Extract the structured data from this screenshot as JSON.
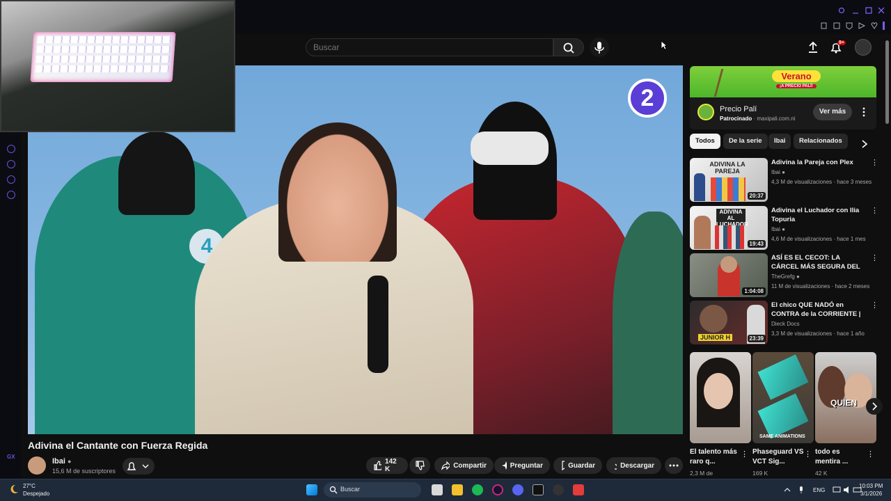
{
  "browser": {
    "accent": "#6b4fd8"
  },
  "header": {
    "search_placeholder": "Buscar",
    "notification_count": "9+"
  },
  "video": {
    "title": "Adivina el Cantante con Fuerza Regida",
    "badge_number": "2",
    "channel": "Ibai",
    "subscribers": "15,6 M de suscriptores",
    "likes": "142 K",
    "share_label": "Compartir",
    "ask_label": "Preguntar",
    "save_label": "Guardar",
    "download_label": "Descargar"
  },
  "ad": {
    "banner_text": "Verano",
    "banner_sub": "¡A PRECIO PALÍ!",
    "name": "Precio Palí",
    "sponsored": "Patrocinado",
    "domain": "maxipali.com.ni",
    "button": "Ver más"
  },
  "chips": [
    "Todos",
    "De la serie",
    "Ibai",
    "Relacionados"
  ],
  "recommendations": [
    {
      "title": "Adivina la Pareja con Plex",
      "channel": "Ibai",
      "meta": "4,3 M de visualizaciones · hace 3 meses",
      "duration": "20:37",
      "thumb_text": "ADIVINA LA PAREJA"
    },
    {
      "title": "Adivina el Luchador con Ilia Topuria",
      "channel": "Ibai",
      "meta": "4,6 M de visualizaciones · hace 1 mes",
      "duration": "19:43",
      "thumb_text": "ADIVINA AL LUCHADOR"
    },
    {
      "title": "ASÍ ES EL CECOT: LA CÁRCEL MÁS SEGURA DEL MUNDO",
      "channel": "TheGrefg",
      "meta": "11 M de visualizaciones · hace 2 meses",
      "duration": "1:04:08",
      "thumb_text": ""
    },
    {
      "title": "El chico QUE NADÓ en CONTRA de la CORRIENTE | Junior H | ...",
      "channel": "Dieck Docs",
      "meta": "3,3 M de visualizaciones · hace 1 año",
      "duration": "23:39",
      "thumb_text": "JUNIOR H"
    }
  ],
  "shorts": [
    {
      "title": "El talento más raro q...",
      "views": "2,3 M de",
      "thumb_text": ""
    },
    {
      "title": "Phaseguard VS VCT Sig...",
      "views": "169 K",
      "thumb_text": "SAME ANIMATIONS"
    },
    {
      "title": "todo es mentira ...",
      "views": "42 K",
      "thumb_text": "QUIEN"
    }
  ],
  "taskbar": {
    "weather_temp": "27°C",
    "weather_desc": "Despejado",
    "search": "Buscar",
    "lang": "ENG",
    "time": "10:03 PM",
    "date": "3/1/2026"
  }
}
